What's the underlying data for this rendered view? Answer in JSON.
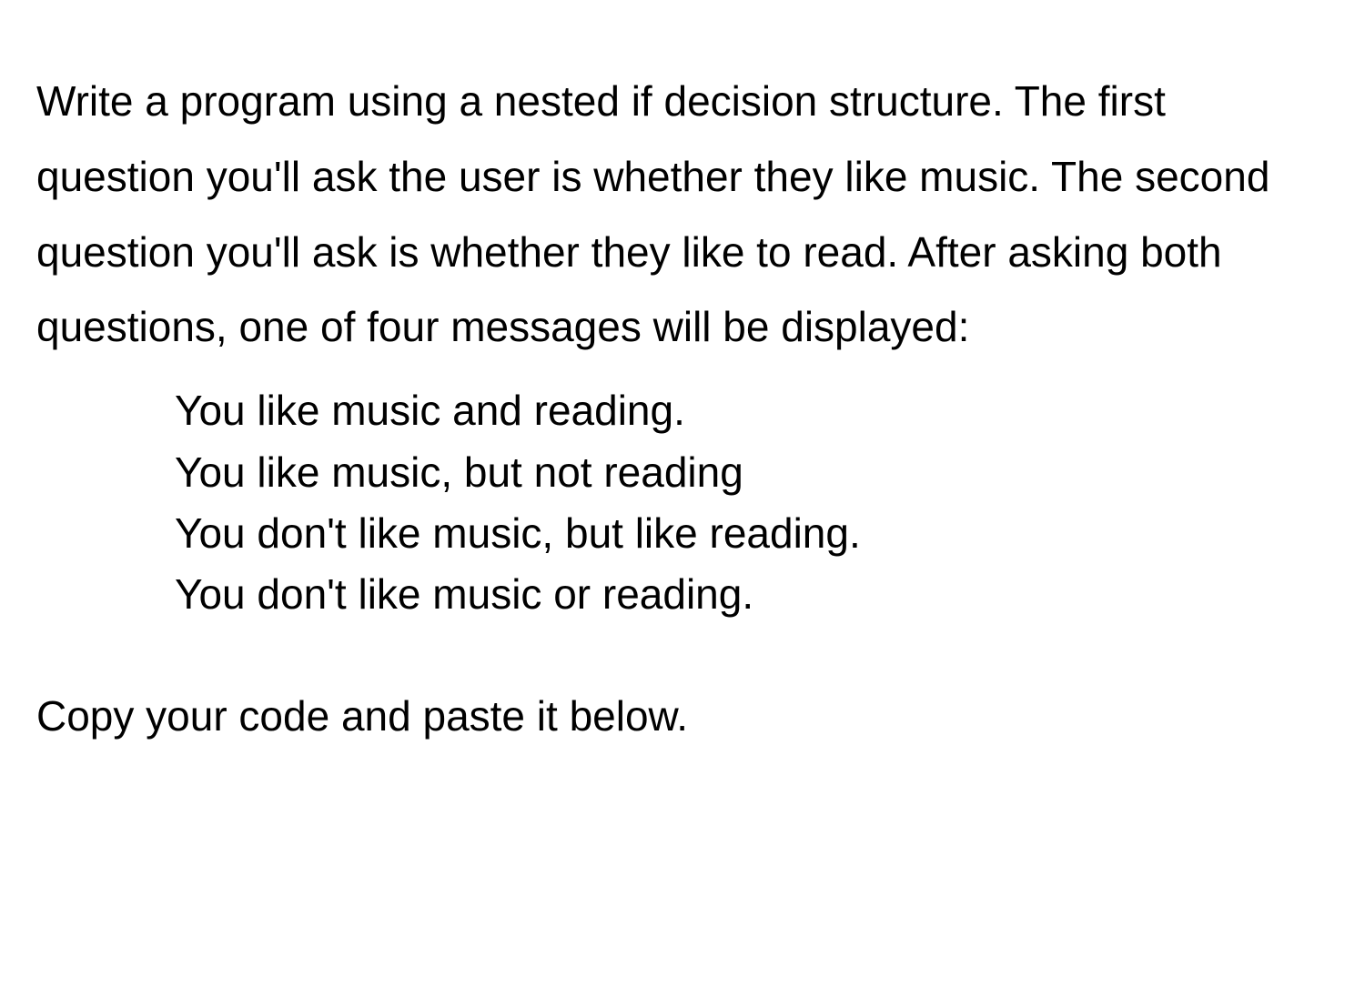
{
  "main": {
    "intro": "Write a program using a nested if decision structure. The first question you'll ask the user is whether they like music. The second question you'll ask is whether they like to read. After asking both questions, one of four messages will be displayed:",
    "messages": [
      "You like music and reading.",
      "You like music, but not reading",
      "You don't like music, but like reading.",
      "You don't like music or reading."
    ],
    "closing": "Copy your code and paste it below."
  }
}
